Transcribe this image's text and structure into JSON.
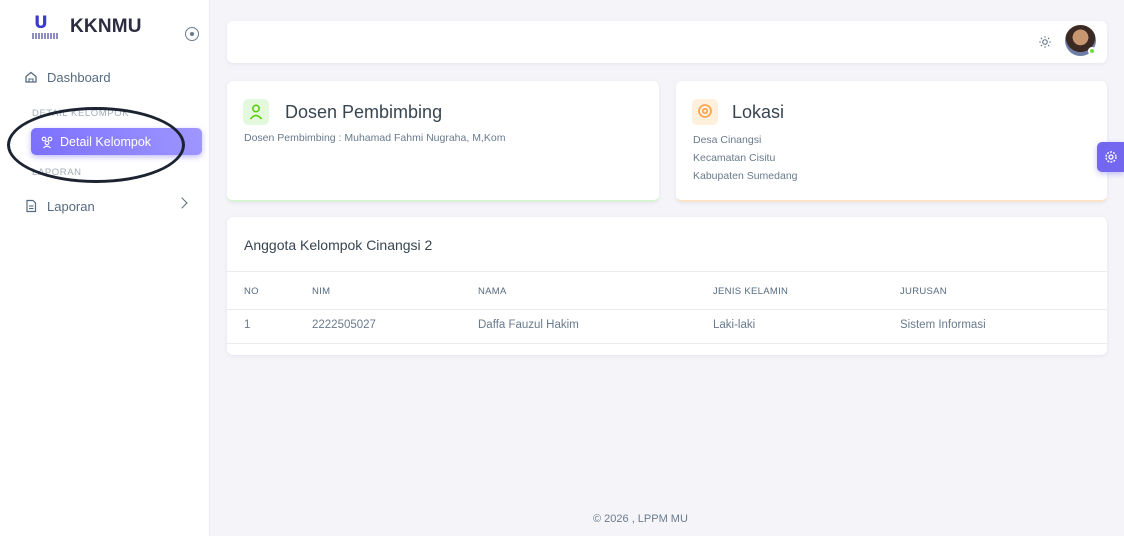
{
  "brand": {
    "name": "KKNMU",
    "logo_icon": "university-logo",
    "toggle_icon": "circle-dot-icon"
  },
  "sidebar": {
    "dashboard_label": "Dashboard",
    "section_detail": "DETAIL KELOMPOK",
    "active_label": "Detail Kelompok",
    "section_laporan": "LAPORAN",
    "laporan_label": "Laporan"
  },
  "navbar": {
    "theme_icon": "sun-icon",
    "avatar_icon": "user-avatar",
    "status": "online"
  },
  "dosen": {
    "title": "Dosen Pembimbing",
    "text": "Dosen Pembimbing : Muhamad Fahmi Nugraha, M,Kom",
    "icon": "user-icon"
  },
  "lokasi": {
    "title": "Lokasi",
    "lines": [
      "Desa Cinangsi",
      "Kecamatan Cisitu",
      "Kabupaten Sumedang"
    ],
    "icon": "map-pin-icon"
  },
  "anggota": {
    "title": "Anggota Kelompok Cinangsi 2",
    "columns": [
      "NO",
      "NIM",
      "NAMA",
      "JENIS KELAMIN",
      "JURUSAN"
    ],
    "rows": [
      [
        "1",
        "2222505027",
        "Daffa Fauzul Hakim",
        "Laki-laki",
        "Sistem Informasi"
      ]
    ]
  },
  "footer": {
    "text": "© 2026 , LPPM MU"
  },
  "colors": {
    "primary": "#7367f0",
    "success": "#71dd37",
    "warning": "#ff9f43",
    "annotation": "#1b2230"
  }
}
